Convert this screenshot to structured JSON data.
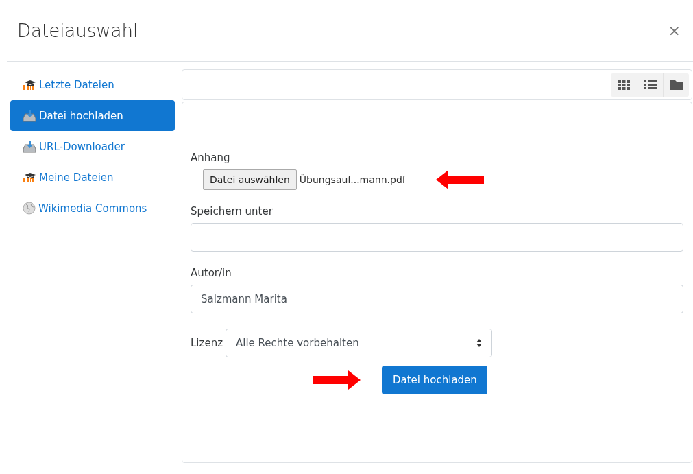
{
  "window": {
    "title": "Dateiauswahl",
    "close": "×"
  },
  "sidebar": {
    "items": [
      {
        "label": "Letzte Dateien",
        "kind": "moodle",
        "selected": false
      },
      {
        "label": "Datei hochladen",
        "kind": "upload",
        "selected": true
      },
      {
        "label": "URL-Downloader",
        "kind": "upload",
        "selected": false
      },
      {
        "label": "Meine Dateien",
        "kind": "moodle",
        "selected": false
      },
      {
        "label": "Wikimedia Commons",
        "kind": "wiki",
        "selected": false
      }
    ]
  },
  "form": {
    "attachment": {
      "label": "Anhang",
      "button": "Datei auswählen",
      "filename": "Übungsauf...mann.pdf"
    },
    "save_as": {
      "label": "Speichern unter"
    },
    "author": {
      "label": "Autor/in",
      "value": "Salzmann Marita"
    },
    "license": {
      "label": "Lizenz",
      "value": "Alle Rechte vorbehalten"
    },
    "submit": "Datei hochladen"
  }
}
